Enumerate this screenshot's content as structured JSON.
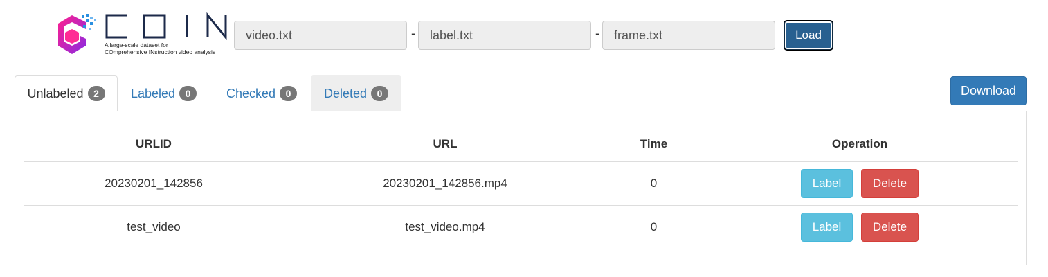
{
  "logo": {
    "brand": "COIN",
    "tagline_line1": "A large-scale dataset for",
    "tagline_line2": "COmprehensive INstruction video analysis"
  },
  "inputs": {
    "video": "video.txt",
    "label": "label.txt",
    "frame": "frame.txt",
    "separator": "-"
  },
  "load_label": "Load",
  "download_label": "Download",
  "tabs": [
    {
      "label": "Unlabeled",
      "count": "2"
    },
    {
      "label": "Labeled",
      "count": "0"
    },
    {
      "label": "Checked",
      "count": "0"
    },
    {
      "label": "Deleted",
      "count": "0"
    }
  ],
  "table": {
    "headers": [
      "URLID",
      "URL",
      "Time",
      "Operation"
    ],
    "rows": [
      {
        "urlid": "20230201_142856",
        "url": "20230201_142856.mp4",
        "time": "0",
        "label_btn": "Label",
        "delete_btn": "Delete"
      },
      {
        "urlid": "test_video",
        "url": "test_video.mp4",
        "time": "0",
        "label_btn": "Label",
        "delete_btn": "Delete"
      }
    ]
  },
  "colors": {
    "primary": "#337ab7",
    "primary_dark": "#286090",
    "info": "#5bc0de",
    "danger": "#d9534f",
    "badge": "#777777",
    "logo_magenta": "#e0147a",
    "logo_purple": "#7b2ccf",
    "logo_blue": "#2a8fe0",
    "logo_text": "#1c2a4a"
  }
}
